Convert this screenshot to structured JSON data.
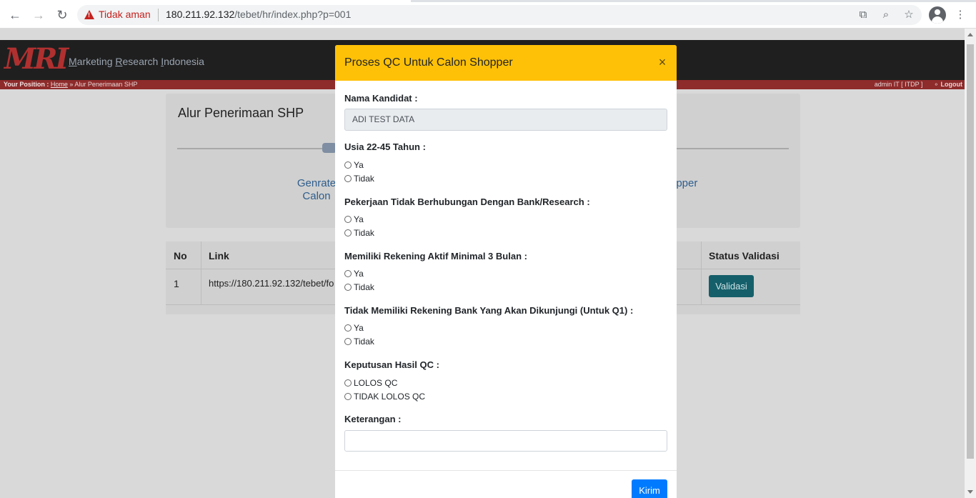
{
  "browser": {
    "security_label": "Tidak aman",
    "url_host": "180.211.92.132",
    "url_path": "/tebet/hr/index.php?p=001"
  },
  "site": {
    "logo_text": "MRI",
    "name_parts": [
      "M",
      "arketing ",
      "R",
      "esearch ",
      "I",
      "ndonesia"
    ],
    "position_label": "Your Position :",
    "home_link": "Home",
    "crumb_sep": " » ",
    "current_page": "Alur Penerimaan SHP",
    "user_info": "admin IT [ ITDP ]",
    "logout_label": "Logout"
  },
  "card": {
    "title": "Alur Penerimaan SHP",
    "step_left": "Genrate\nCalon",
    "step_right": "opper"
  },
  "table": {
    "headers": [
      "No",
      "Link",
      "Status Validasi"
    ],
    "rows": [
      {
        "no": "1",
        "link": "https://180.211.92.132/tebet/fo",
        "action": "Validasi"
      }
    ]
  },
  "modal": {
    "title": "Proses QC Untuk Calon Shopper",
    "close_glyph": "×",
    "nama_label": "Nama Kandidat :",
    "nama_value": "ADI TEST DATA",
    "q1_label": "Usia 22-45 Tahun :",
    "q2_label": "Pekerjaan Tidak Berhubungan Dengan Bank/Research :",
    "q3_label": "Memiliki Rekening Aktif Minimal 3 Bulan :",
    "q4_label": "Tidak Memiliki Rekening Bank Yang Akan Dikunjungi (Untuk Q1) :",
    "yes": "Ya",
    "no": "Tidak",
    "decision_label": "Keputusan Hasil QC :",
    "pass": "LOLOS QC",
    "fail": "TIDAK LOLOS QC",
    "note_label": "Keterangan :",
    "note_value": "",
    "submit": "Kirim"
  }
}
